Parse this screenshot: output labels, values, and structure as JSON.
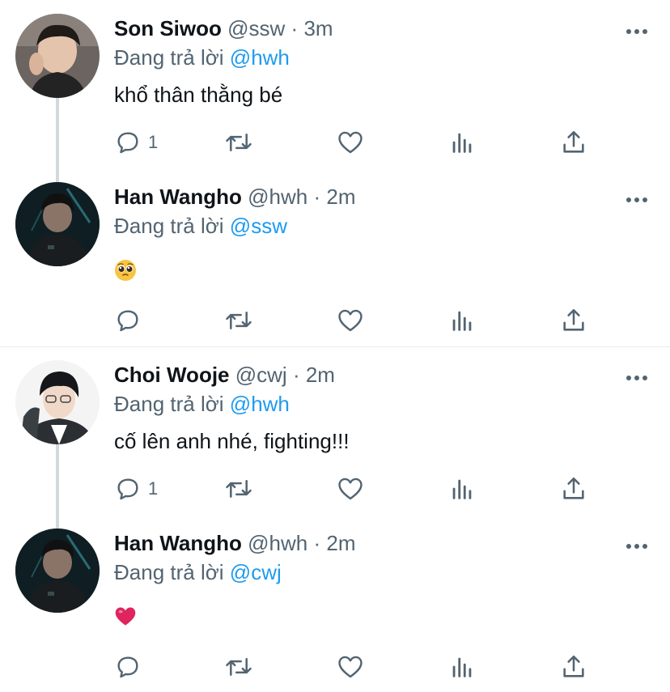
{
  "tweets": [
    {
      "name": "Son Siwoo",
      "handle": "@ssw",
      "dot": "·",
      "time": "3m",
      "reply_prefix": "Đang trả lời",
      "reply_to": "@hwh",
      "text": "khổ thân thằng bé",
      "emoji": "",
      "reply_count": "1"
    },
    {
      "name": "Han Wangho",
      "handle": "@hwh",
      "dot": "·",
      "time": "2m",
      "reply_prefix": "Đang trả lời",
      "reply_to": "@ssw",
      "text": "",
      "emoji": "pleading-face",
      "reply_count": ""
    },
    {
      "name": "Choi Wooje",
      "handle": "@cwj",
      "dot": "·",
      "time": "2m",
      "reply_prefix": "Đang trả lời",
      "reply_to": "@hwh",
      "text": "cố lên anh nhé, fighting!!!",
      "emoji": "",
      "reply_count": "1"
    },
    {
      "name": "Han Wangho",
      "handle": "@hwh",
      "dot": "·",
      "time": "2m",
      "reply_prefix": "Đang trả lời",
      "reply_to": "@cwj",
      "text": "",
      "emoji": "red-heart",
      "reply_count": ""
    }
  ],
  "icons": {
    "reply": "reply-icon",
    "retweet": "retweet-icon",
    "like": "like-icon",
    "analytics": "analytics-icon",
    "share": "share-icon",
    "more": "more-icon"
  },
  "colors": {
    "mention": "#1d9bf0",
    "secondary_text": "#536471",
    "thread_line": "#cfd9de",
    "heart_emoji": "#e0245e"
  }
}
